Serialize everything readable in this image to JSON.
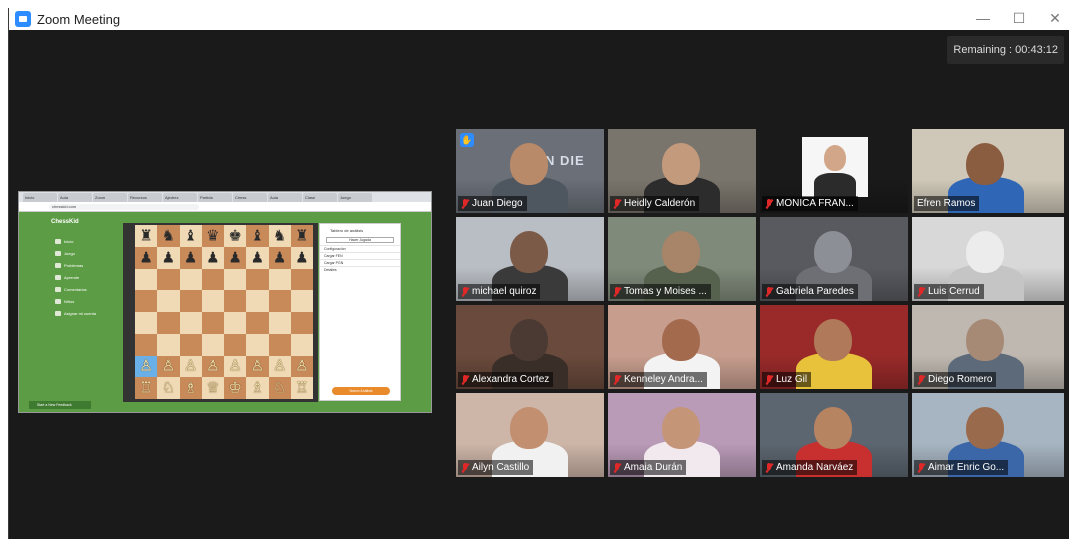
{
  "window": {
    "title": "Zoom Meeting",
    "controls": {
      "minimize": "—",
      "maximize": "☐",
      "close": "✕"
    }
  },
  "meeting": {
    "remaining": "Remaining : 00:43:12"
  },
  "shared_screen": {
    "browser_tabs": [
      "Inicio",
      "Aula",
      "Zoom",
      "Recursos",
      "Ajedrez",
      "Partida",
      "Chess",
      "Aula",
      "Clase",
      "Juego"
    ],
    "address": "chesskid.com",
    "site_logo": "ChessKid",
    "nav_items": [
      "Inicio",
      "Juego",
      "Problemas",
      "Aprende",
      "Comentarios",
      "Niños",
      "Asignar mi cuenta"
    ],
    "panel": {
      "title": "Tablero de análisis",
      "button": "Hacer Jugada",
      "rows": [
        "Configuración",
        "Cargar FEN",
        "Cargar PGN",
        "Detalles"
      ],
      "action": "Nuevo Análisis"
    },
    "footer_link": "Start a New Feedback",
    "board": [
      [
        "♜",
        "♞",
        "♝",
        "♛",
        "♚",
        "♝",
        "♞",
        "♜"
      ],
      [
        "♟",
        "♟",
        "♟",
        "♟",
        "♟",
        "♟",
        "♟",
        "♟"
      ],
      [
        "",
        "",
        "",
        "",
        "",
        "",
        "",
        ""
      ],
      [
        "",
        "",
        "",
        "",
        "",
        "",
        "",
        ""
      ],
      [
        "",
        "",
        "",
        "",
        "",
        "",
        "",
        ""
      ],
      [
        "",
        "",
        "",
        "",
        "",
        "",
        "",
        ""
      ],
      [
        "♙",
        "♙",
        "♙",
        "♙",
        "♙",
        "♙",
        "♙",
        "♙"
      ],
      [
        "♖",
        "♘",
        "♗",
        "♕",
        "♔",
        "♗",
        "♘",
        "♖"
      ]
    ]
  },
  "participants": [
    {
      "name": "Juan Diego",
      "hand_raised": true,
      "bg": "#6a6f78",
      "face": "#b88a6a",
      "shirt": "#4e5660",
      "extra_text": "JUAN DIE"
    },
    {
      "name": "Heidly Calderón",
      "bg": "#7a756c",
      "face": "#c49a7c",
      "shirt": "#2c2c2c"
    },
    {
      "name": "MONICA FRAN...",
      "bg": "#1a1a1a",
      "face": "#d2a689",
      "shirt": "#f1f1f1",
      "photo": true
    },
    {
      "name": "Efren Ramos",
      "active_speaker": true,
      "bg": "#cfc8b8",
      "face": "#8a5c40",
      "shirt": "#2f66b5"
    },
    {
      "name": "michael quiroz",
      "bg": "#b9bec4",
      "face": "#7c5a48",
      "shirt": "#3a3a3a"
    },
    {
      "name": "Tomas y Moises ...",
      "bg": "#7f8a7a",
      "face": "#a88468",
      "shirt": "#56624e"
    },
    {
      "name": "Gabriela Paredes",
      "bg": "#595a60",
      "face": "#8c8f95",
      "shirt": "#6d6f74"
    },
    {
      "name": "Luis Cerrud",
      "bg": "#d8d8d8",
      "face": "#ececec",
      "shirt": "#c5c5c5"
    },
    {
      "name": "Alexandra Cortez",
      "bg": "#6a4a3c",
      "face": "#4a3a33",
      "shirt": "#3a2e28"
    },
    {
      "name": "Kenneley Andra...",
      "bg": "#c79e8e",
      "face": "#a46a4e",
      "shirt": "#f3f3f3"
    },
    {
      "name": "Luz Gil",
      "bg": "#9a2a2a",
      "face": "#b07a5a",
      "shirt": "#e8c23a"
    },
    {
      "name": "Diego Romero",
      "bg": "#bfb8b0",
      "face": "#a78a76",
      "shirt": "#5c6a7a"
    },
    {
      "name": "Ailyn Castillo",
      "bg": "#cdb5a8",
      "face": "#c28f70",
      "shirt": "#f1f1f1"
    },
    {
      "name": "Amaia Durán",
      "bg": "#b99ab7",
      "face": "#c59578",
      "shirt": "#f2e9ef"
    },
    {
      "name": "Amanda Narváez",
      "bg": "#5c6670",
      "face": "#b78462",
      "shirt": "#c82f2f"
    },
    {
      "name": "Aimar Enric Go...",
      "bg": "#a7b5c2",
      "face": "#9a6a4c",
      "shirt": "#3b66a8"
    }
  ],
  "colors": {
    "background": "#1a1a1a",
    "active_speaker_border": "#c9e24b",
    "mute": "#e02828",
    "zoom_blue": "#2d8cff"
  }
}
